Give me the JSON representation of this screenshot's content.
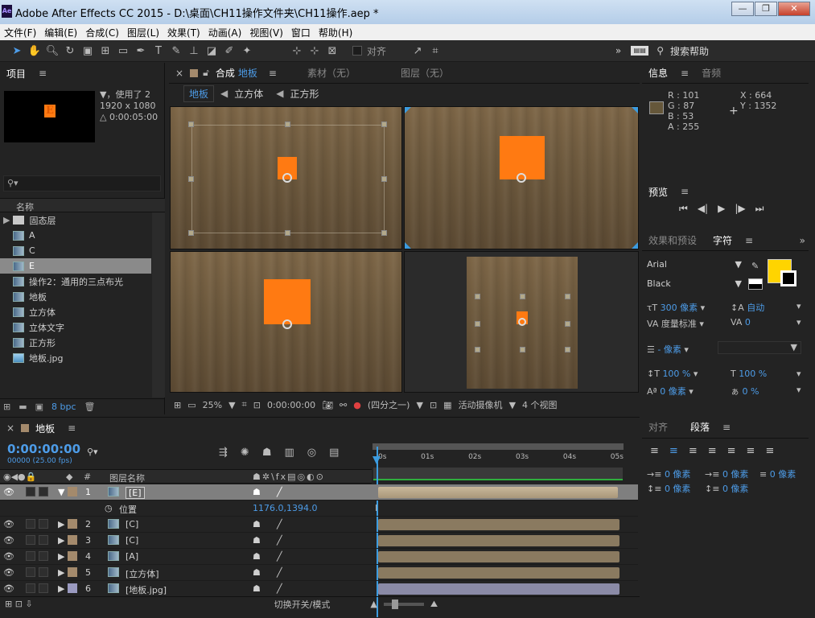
{
  "window": {
    "title": "Adobe After Effects CC 2015 - D:\\桌面\\CH11操作文件夹\\CH11操作.aep *",
    "app_icon": "Ae",
    "minimize": "—",
    "restore": "❐",
    "close": "✕"
  },
  "menu": [
    "文件(F)",
    "编辑(E)",
    "合成(C)",
    "图层(L)",
    "效果(T)",
    "动画(A)",
    "视图(V)",
    "窗口",
    "帮助(H)"
  ],
  "toolbar": {
    "align_label": "对齐",
    "search_help": "搜索帮助",
    "expand": "»"
  },
  "project": {
    "tab": "项目",
    "thumb_letter": "E",
    "info_line1": "▼，使用了 2",
    "info_line2": "1920 x 1080",
    "info_line3": "△ 0:00:05:00",
    "col_name": "名称",
    "bpc": "8 bpc",
    "items": [
      {
        "type": "folder",
        "name": "固态层"
      },
      {
        "type": "comp",
        "name": "A"
      },
      {
        "type": "comp",
        "name": "C"
      },
      {
        "type": "comp",
        "name": "E"
      },
      {
        "type": "comp",
        "name": "操作2：通用的三点布光"
      },
      {
        "type": "comp",
        "name": "地板"
      },
      {
        "type": "comp",
        "name": "立方体"
      },
      {
        "type": "comp",
        "name": "立体文字"
      },
      {
        "type": "comp",
        "name": "正方形"
      },
      {
        "type": "image",
        "name": "地板.jpg"
      }
    ]
  },
  "comp": {
    "close": "×",
    "tab_prefix": "合成",
    "tab_name": "地板",
    "material_tab": "素材（无）",
    "layer_tab": "图层（无）",
    "breadcrumbs": [
      "地板",
      "立方体",
      "正方形"
    ],
    "zoom": "25%",
    "timecode": "0:00:00:00",
    "view_layout": "(四分之一)",
    "camera": "活动摄像机",
    "views": "4 个视图"
  },
  "info": {
    "tab": "信息",
    "audio_tab": "音频",
    "r": "R : 101",
    "g": "G : 87",
    "b": "B : 53",
    "a": "A : 255",
    "x": "X : 664",
    "y": "Y : 1352",
    "swatch": "#65573a"
  },
  "preview": {
    "tab": "预览"
  },
  "character": {
    "effects_tab": "效果和预设",
    "tab": "字符",
    "font": "Arial",
    "style": "Black",
    "size": "300 像素",
    "leading": "自动",
    "kerning": "度量标准",
    "tracking": "0",
    "stroke": "- 像素",
    "vscale": "100 %",
    "hscale": "100 %",
    "baseline": "0 像素",
    "tsume": "0 %",
    "fill_color": "#ffd400"
  },
  "paragraph": {
    "align_tab": "对齐",
    "tab": "段落",
    "indent_left": "0 像素",
    "indent_first": "0 像素",
    "indent_right": "0 像素",
    "space_before": "0 像素",
    "space_after": "0 像素"
  },
  "timeline": {
    "close": "×",
    "tab": "地板",
    "timecode": "0:00:00:00",
    "fps": "00000 (25.00 fps)",
    "col_num": "#",
    "col_name": "图层名称",
    "toggle": "切换开关/模式",
    "ticks": [
      "0s",
      "01s",
      "02s",
      "03s",
      "04s",
      "05s"
    ],
    "layers": [
      {
        "num": "1",
        "name": "[E]",
        "color": "#a48a6c",
        "selected": true
      },
      {
        "num": "",
        "name": "位置",
        "value": "1176.0,1394.0",
        "sub": true
      },
      {
        "num": "2",
        "name": "[C]",
        "color": "#a48a6c"
      },
      {
        "num": "3",
        "name": "[C]",
        "color": "#a48a6c"
      },
      {
        "num": "4",
        "name": "[A]",
        "color": "#a48a6c"
      },
      {
        "num": "5",
        "name": "[立方体]",
        "color": "#a48a6c"
      },
      {
        "num": "6",
        "name": "[地板.jpg]",
        "color": "#9a9ac0"
      }
    ]
  }
}
